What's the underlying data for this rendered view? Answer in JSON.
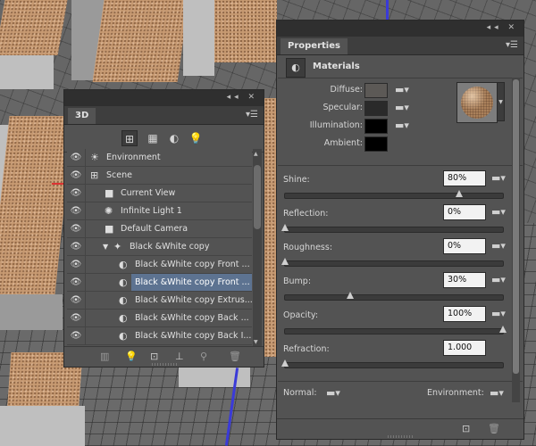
{
  "panel_3d": {
    "tab_label": "3D",
    "window_controls": "◂◂ ✕",
    "toolbar_icons": [
      "scene-icon",
      "mesh-icon",
      "material-icon",
      "light-icon"
    ],
    "layers": [
      {
        "label": "Environment",
        "icon": "environment-icon",
        "indent": 0,
        "expand": ""
      },
      {
        "label": "Scene",
        "icon": "scene-icon",
        "indent": 0,
        "expand": ""
      },
      {
        "label": "Current View",
        "icon": "camera-icon",
        "indent": 1,
        "expand": ""
      },
      {
        "label": "Infinite Light 1",
        "icon": "light-icon",
        "indent": 1,
        "expand": ""
      },
      {
        "label": "Default Camera",
        "icon": "camera-icon",
        "indent": 1,
        "expand": ""
      },
      {
        "label": "Black &White copy",
        "icon": "mesh-icon",
        "indent": 1,
        "expand": "▼"
      },
      {
        "label": "Black &White copy Front ...",
        "icon": "material-icon",
        "indent": 2,
        "expand": ""
      },
      {
        "label": "Black &White copy Front ...",
        "icon": "material-icon",
        "indent": 2,
        "expand": "",
        "selected": true
      },
      {
        "label": "Black &White copy Extrus...",
        "icon": "material-icon",
        "indent": 2,
        "expand": ""
      },
      {
        "label": "Black &White copy Back ...",
        "icon": "material-icon",
        "indent": 2,
        "expand": ""
      },
      {
        "label": "Black &White copy Back I...",
        "icon": "material-icon",
        "indent": 2,
        "expand": ""
      }
    ],
    "bottom_icons": [
      "render-icon",
      "add-light-icon",
      "new-mesh-icon",
      "ground-icon",
      "move-light-icon",
      "trash-icon"
    ]
  },
  "properties": {
    "tab_label": "Properties",
    "window_controls": "◂◂ ✕",
    "section_title": "Materials",
    "materials": [
      {
        "label": "Diffuse:",
        "color": "#5c5956"
      },
      {
        "label": "Specular:",
        "color": "#2a2a2a"
      },
      {
        "label": "Illumination:",
        "color": "#000000"
      },
      {
        "label": "Ambient:",
        "color": "#000000"
      }
    ],
    "params": [
      {
        "label": "Shine:",
        "value": "80%",
        "slider": 0.8
      },
      {
        "label": "Reflection:",
        "value": "0%",
        "slider": 0.0
      },
      {
        "label": "Roughness:",
        "value": "0%",
        "slider": 0.0
      },
      {
        "label": "Bump:",
        "value": "30%",
        "slider": 0.3
      },
      {
        "label": "Opacity:",
        "value": "100%",
        "slider": 1.0
      },
      {
        "label": "Refraction:",
        "value": "1.000",
        "slider": 0.0
      }
    ],
    "normal_label": "Normal:",
    "environment_label": "Environment:",
    "footer_icons": [
      "render-icon",
      "trash-icon"
    ]
  }
}
